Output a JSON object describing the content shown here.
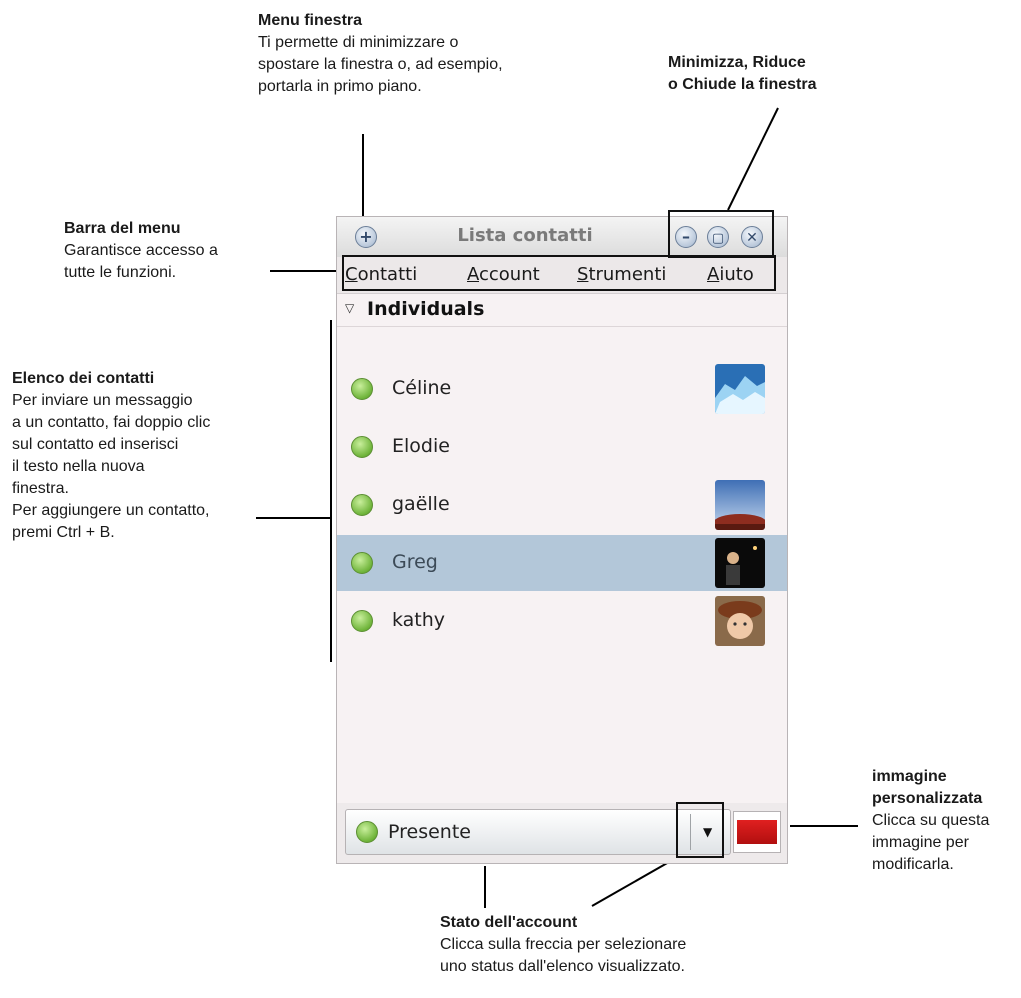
{
  "annotations": {
    "window_menu": {
      "title": "Menu finestra",
      "body": "Ti permette di minimizzare o\nspostare la finestra o, ad esempio,\nportarla in primo piano."
    },
    "window_controls": {
      "title": "Minimizza, Riduce\no Chiude la finestra"
    },
    "menubar": {
      "title": "Barra del menu",
      "body": "Garantisce accesso a\ntutte le funzioni."
    },
    "contact_list": {
      "title": "Elenco dei contatti",
      "body": "Per inviare un messaggio\na un contatto, fai doppio clic\nsul contatto ed inserisci\nil testo nella nuova\nfinestra.\nPer aggiungere un contatto,\npremi Ctrl + B."
    },
    "custom_image": {
      "title": "immagine\npersonalizzata",
      "body": "Clicca su questa\nimmagine per\nmodificarla."
    },
    "account_status": {
      "title": "Stato dell'account",
      "body": "Clicca sulla freccia per selezionare\nuno status dall'elenco visualizzato."
    }
  },
  "window": {
    "title": "Lista contatti",
    "menu_icon": "plus-circle-icon",
    "controls": [
      "minimize-icon",
      "maximize-icon",
      "close-icon"
    ],
    "menu": [
      {
        "first": "C",
        "rest": "ontatti"
      },
      {
        "first": "A",
        "rest": "ccount"
      },
      {
        "first": "S",
        "rest": "trumenti"
      },
      {
        "first": "A",
        "rest": "iuto"
      }
    ],
    "group": "Individuals",
    "contacts": [
      {
        "name": "Céline",
        "avatar": "ice-photo",
        "selected": false
      },
      {
        "name": "Elodie",
        "avatar": "",
        "selected": false
      },
      {
        "name": "gaëlle",
        "avatar": "desert-rock-photo",
        "selected": false
      },
      {
        "name": "Greg",
        "avatar": "night-person-photo",
        "selected": true
      },
      {
        "name": "kathy",
        "avatar": "child-hat-photo",
        "selected": false
      }
    ],
    "status": "Presente",
    "colors": {
      "selection": "#b3c7d9",
      "available": "#6fb43a"
    }
  }
}
